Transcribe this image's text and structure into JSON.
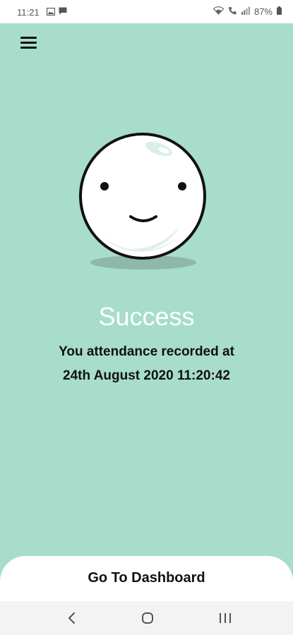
{
  "status_bar": {
    "time": "11:21",
    "battery": "87%",
    "icons": [
      "image-icon",
      "message-icon",
      "wifi-icon",
      "call-icon",
      "signal-icon",
      "battery-icon"
    ]
  },
  "header": {
    "menu_icon": "hamburger-menu-icon"
  },
  "illustration": {
    "name": "smiling-face-character"
  },
  "main": {
    "title": "Success",
    "message_line1": "You attendance recorded at",
    "message_line2": "24th August 2020 11:20:42"
  },
  "footer": {
    "dashboard_label": "Go To Dashboard"
  },
  "nav_bar": {
    "icons": [
      "back-icon",
      "home-icon",
      "recent-apps-icon"
    ]
  },
  "colors": {
    "background": "#a7ddca",
    "title": "#ffffff",
    "text": "#111111",
    "button_bg": "#ffffff"
  }
}
